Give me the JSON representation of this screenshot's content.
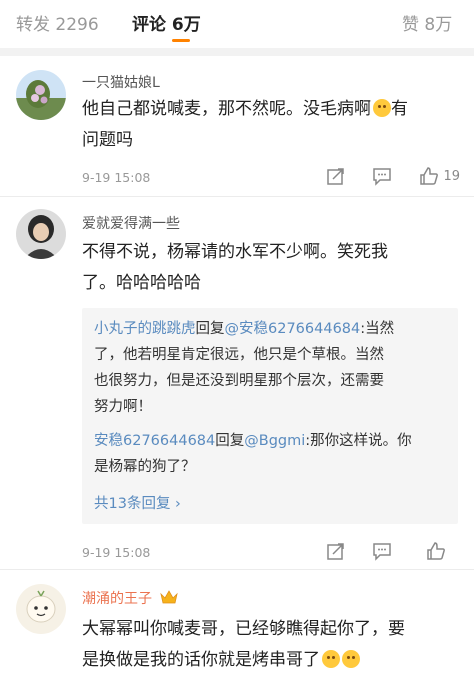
{
  "tabs": {
    "repost": "转发 2296",
    "comments": "评论 6万",
    "likes": "赞 8万"
  },
  "comments": [
    {
      "username": "一只猫姑娘L",
      "text_1": "他自己都说喊麦，那不然呢。没毛病啊",
      "text_2": "有",
      "text_3": "问题吗",
      "emoji": "dizzy-face",
      "time": "9-19 15:08",
      "like_count": "19"
    },
    {
      "username": "爱就爱得满一些",
      "text_1": "不得不说，杨幂请的水军不少啊。笑死我",
      "text_2": "了。哈哈哈哈哈",
      "replies": [
        {
          "user": "小丸子的跳跳虎",
          "verb": "回复",
          "target": "@安稳6276644684",
          "line_1_rest": ":当然",
          "line_2": "了，他若明星肯定很远，他只是个草根。当然",
          "line_3": "也很努力，但是还没到明星那个层次，还需要",
          "line_4": "努力啊！"
        },
        {
          "user": "安稳6276644684",
          "verb": "回复",
          "target": "@Bggmi",
          "line_1_rest": ":那你这样说。你",
          "line_2": "是杨幂的狗了？"
        }
      ],
      "more_replies": "共13条回复 ›",
      "time": "9-19 15:08",
      "like_count": ""
    },
    {
      "username": "潮涌的王子",
      "text_1": "大幂幂叫你喊麦哥，已经够瞧得起你了，要",
      "text_2": "是换做是我的话你就是烤串哥了",
      "emoji": "grin-face"
    }
  ],
  "colors": {
    "accent": "#ff8200",
    "link": "#5a8bbf",
    "vip_name": "#eb7350"
  }
}
